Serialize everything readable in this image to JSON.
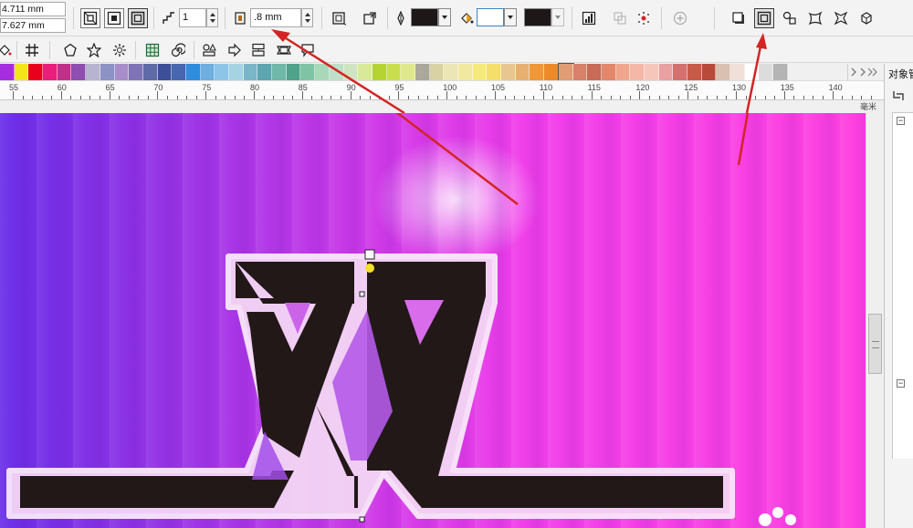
{
  "property_bar": {
    "width_value": "4.711 mm",
    "height_value": "7.627 mm",
    "step_count": "1",
    "offset_value": ".8 mm"
  },
  "colors": {
    "outline_swatch": "#1e1717",
    "fill_swatch": "#ffffff",
    "shadow_swatch": "#1e1717",
    "arrow": "#d42424",
    "letter_fill": "#221818",
    "contour_fill": "#f4d6f5"
  },
  "icons": {
    "contour_to_center": "contour-to-center-icon",
    "contour_inside": "contour-inside-icon",
    "contour_outside": "contour-outside-icon",
    "steps": "contour-steps-icon",
    "offset": "contour-offset-icon",
    "corners": "contour-corners-icon",
    "color_direction": "color-direction-icon",
    "outline_pen": "outline-pen-icon",
    "fill_bucket": "fill-bucket-icon",
    "object_accel": "object-acceleration-icon",
    "copy_properties": "copy-properties-icon",
    "clear_contour": "clear-contour-icon",
    "add_preset": "add-preset-icon",
    "back_minus_front": "back-minus-front-icon",
    "outer_contour": "outer-contour-icon",
    "blend": "blend-icon",
    "distort": "distort-icon",
    "envelope": "envelope-icon",
    "extrude": "extrude-icon"
  },
  "ruler": {
    "labels": [
      "55",
      "60",
      "65",
      "70",
      "75",
      "80",
      "85",
      "90",
      "95",
      "100",
      "105",
      "110",
      "115",
      "120",
      "125",
      "130",
      "135",
      "140"
    ],
    "unit": "毫米"
  },
  "palette": [
    "#a62de0",
    "#f2e61a",
    "#e8001c",
    "#e91e7a",
    "#c0308a",
    "#8e4fb0",
    "#b7b4cf",
    "#8d92c5",
    "#a78ec8",
    "#8173b8",
    "#5f6aa8",
    "#3d4f99",
    "#4767b0",
    "#2f8de0",
    "#6eaee0",
    "#8cc5e8",
    "#a6d3e2",
    "#7ab6c8",
    "#5da5b0",
    "#6fb7a9",
    "#4ea38a",
    "#7ec4a4",
    "#a8d8b8",
    "#bfe0c8",
    "#cfe5c0",
    "#d8ea9a",
    "#b6d334",
    "#c9de4c",
    "#e0e88c",
    "#a9a89a",
    "#d8d2a4",
    "#ece6b4",
    "#f2e9a0",
    "#f6ea7a",
    "#f5de6a",
    "#e8c690",
    "#e8b070",
    "#f09838",
    "#ec8a2a",
    "#e09c72",
    "#d8806a",
    "#c86a56",
    "#e2876c",
    "#f0a68c",
    "#f5b8a8",
    "#f7c6bb",
    "#e8a0a0",
    "#d47070",
    "#c85a48",
    "#b84a3a",
    "#d9c0b0",
    "#f0e0d8",
    "#ffffff",
    "#dcdcdc",
    "#b4b4b4"
  ],
  "docker": {
    "title": "对象管"
  },
  "canvas": {
    "artwork": "XX"
  }
}
